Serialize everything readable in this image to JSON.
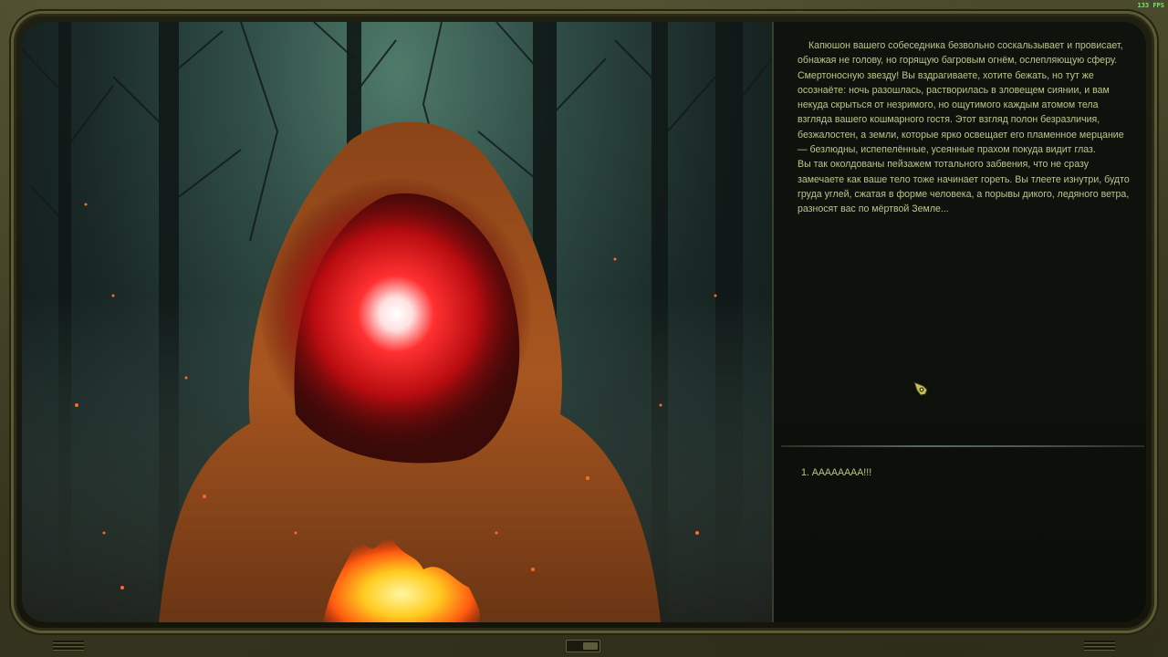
{
  "hud": {
    "fps": "133 FPS"
  },
  "story": {
    "paragraphs": [
      "Капюшон вашего собеседника безвольно соскальзывает и провисает, обнажая не голову, но горящую багровым огнём, ослепляющую сферу. Смертоносную звезду! Вы вздрагиваете, хотите бежать, но тут же осознаёте: ночь разошлась, растворилась в зловещем сиянии, и вам некуда скрыться от незримого, но ощутимого каждым атомом тела взгляда вашего кошмарного гостя. Этот взгляд полон безразличия, безжалостен, а земли, которые ярко освещает его пламенное мерцание — безлюдны, испепелённые, усеянные прахом покуда видит глаз.",
      "Вы так околдованы пейзажем тотального забвения, что не сразу замечаете как ваше тело тоже начинает гореть. Вы тлеете изнутри, будто груда углей, сжатая в форме человека, а порывы дикого, ледяного ветра, разносят вас по мёртвой Земле..."
    ]
  },
  "choices": [
    {
      "label": "1. ААААААAA!!!"
    }
  ],
  "icons": {
    "cursor": "gauntlet-cursor-icon"
  },
  "colors": {
    "text": "#b8c88a",
    "fps": "#52ff52",
    "frame": "#3b3b22",
    "cloak": "#a8521c",
    "star": "#e01818"
  }
}
